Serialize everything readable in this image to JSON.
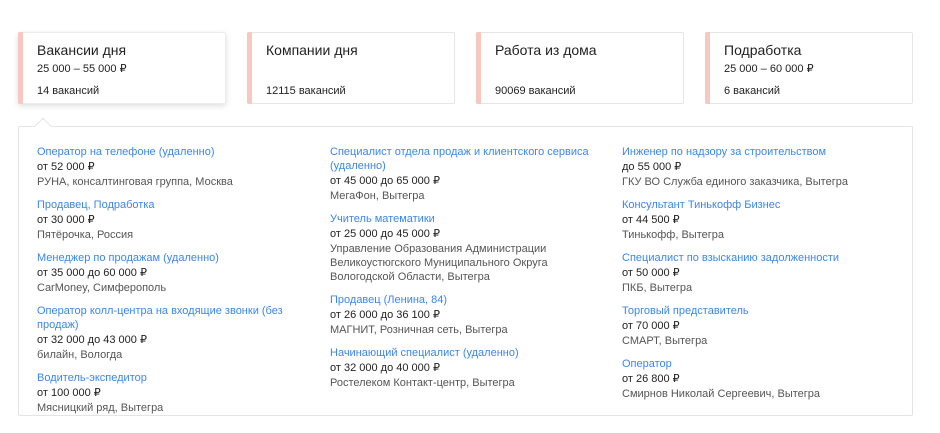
{
  "tabs": [
    {
      "title": "Вакансии дня",
      "salary": "25 000 – 55 000 ₽",
      "count": "14 вакансий"
    },
    {
      "title": "Компании дня",
      "salary": "",
      "count": "12115 вакансий"
    },
    {
      "title": "Работа из дома",
      "salary": "",
      "count": "90069 вакансий"
    },
    {
      "title": "Подработка",
      "salary": "25 000 – 60 000 ₽",
      "count": "6 вакансий"
    }
  ],
  "columns": [
    [
      {
        "title": "Оператор на телефоне (удаленно)",
        "salary": "от 52 000 ₽",
        "company": "РУНА, консалтинговая группа, Москва"
      },
      {
        "title": "Продавец, Подработка",
        "salary": "от 30 000 ₽",
        "company": "Пятёрочка, Россия"
      },
      {
        "title": "Менеджер по продажам (удаленно)",
        "salary": "от 35 000 до 60 000 ₽",
        "company": "CarMoney, Симферополь"
      },
      {
        "title": "Оператор колл-центра на входящие звонки (без продаж)",
        "salary": "от 32 000 до 43 000 ₽",
        "company": "билайн, Вологда"
      },
      {
        "title": "Водитель-экспедитор",
        "salary": "от 100 000 ₽",
        "company": "Мясницкий ряд, Вытегра"
      }
    ],
    [
      {
        "title": "Специалист отдела продаж и клиентского сервиса (удаленно)",
        "salary": "от 45 000 до 65 000 ₽",
        "company": "МегаФон, Вытегра"
      },
      {
        "title": "Учитель математики",
        "salary": "от 25 000 до 45 000 ₽",
        "company": "Управление Образования Администрации Великоустюгского Муниципального Округа Вологодской Области, Вытегра"
      },
      {
        "title": "Продавец (Ленина, 84)",
        "salary": "от 26 000 до 36 100 ₽",
        "company": "МАГНИТ, Розничная сеть, Вытегра"
      },
      {
        "title": "Начинающий специалист (удаленно)",
        "salary": "от 32 000 до 40 000 ₽",
        "company": "Ростелеком Контакт-центр, Вытегра"
      }
    ],
    [
      {
        "title": "Инженер по надзору за строительством",
        "salary": "до 55 000 ₽",
        "company": "ГКУ ВО Служба единого заказчика, Вытегра"
      },
      {
        "title": "Консультант Тинькофф Бизнес",
        "salary": "от 44 500 ₽",
        "company": "Тинькофф, Вытегра"
      },
      {
        "title": "Специалист по взысканию задолженности",
        "salary": "от 50 000 ₽",
        "company": "ПКБ, Вытегра"
      },
      {
        "title": "Торговый представитель",
        "salary": "от 70 000 ₽",
        "company": "СМАРТ, Вытегра"
      },
      {
        "title": "Оператор",
        "salary": "от 26 800 ₽",
        "company": "Смирнов Николай Сергеевич, Вытегра"
      }
    ]
  ],
  "colors": {
    "accent_link": "#3b87e6",
    "tab_stripe": "#f7c8c2"
  }
}
